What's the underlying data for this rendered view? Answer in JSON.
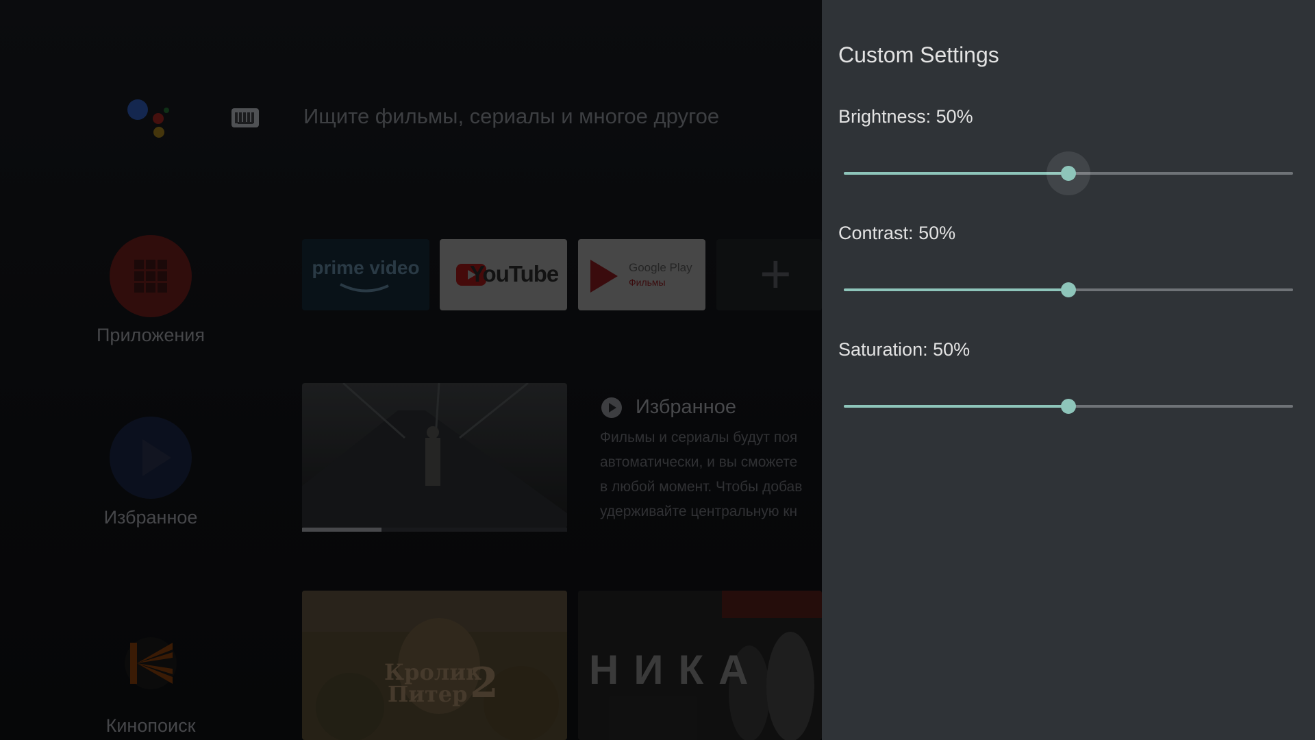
{
  "home": {
    "search_placeholder": "Ищите фильмы, сериалы и многое другое",
    "sidebar": [
      {
        "label": "Приложения",
        "icon": "apps-grid-icon"
      },
      {
        "label": "Избранное",
        "icon": "play-icon"
      },
      {
        "label": "Кинопоиск",
        "icon": "kinopoisk-logo"
      }
    ],
    "app_tiles": [
      {
        "label": "prime video",
        "icon": "prime-video-logo"
      },
      {
        "label": "YouTube",
        "icon": "youtube-logo"
      },
      {
        "label": "Google Play",
        "sublabel": "Фильмы",
        "icon": "google-play-movies-logo"
      }
    ],
    "add_icon": "plus-icon",
    "favorites": {
      "title": "Избранное",
      "description_lines": [
        "Фильмы и сериалы будут поя",
        "автоматически, и вы сможете",
        "в любой момент. Чтобы добав",
        "удерживайте центральную кн"
      ],
      "progress_percent": 30
    },
    "posters": [
      {
        "title_line1": "Кролик",
        "title_line2": "Питер",
        "number": "2"
      },
      {
        "title": "НИКА"
      }
    ]
  },
  "panel": {
    "title": "Custom Settings",
    "settings": [
      {
        "label": "Brightness",
        "value_text": "50%",
        "value": 50,
        "focused": true
      },
      {
        "label": "Contrast",
        "value_text": "50%",
        "value": 50,
        "focused": false
      },
      {
        "label": "Saturation",
        "value_text": "50%",
        "value": 50,
        "focused": false
      }
    ]
  },
  "colors": {
    "panel_bg": "#2f3337",
    "accent": "#8ec5ba",
    "track": "#6f7377"
  }
}
